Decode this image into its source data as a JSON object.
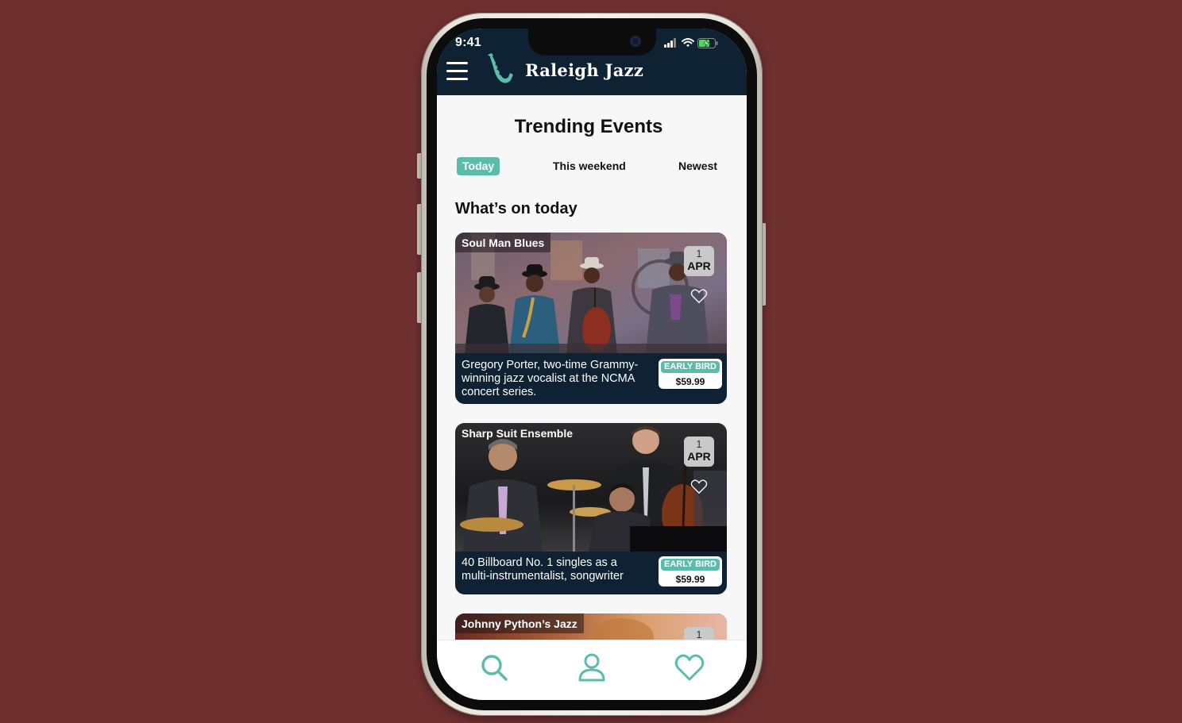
{
  "status_bar": {
    "time": "9:41"
  },
  "app": {
    "name": "Raleigh Jazz"
  },
  "page": {
    "title": "Trending Events"
  },
  "tabs": [
    {
      "label": "Today",
      "active": true
    },
    {
      "label": "This weekend",
      "active": false
    },
    {
      "label": "Newest",
      "active": false
    }
  ],
  "section": {
    "heading": "What’s on today"
  },
  "events": [
    {
      "title": "Soul Man Blues",
      "day": "1",
      "month": "APR",
      "desc_lines": [
        "Gregory Porter, two-time Grammy-",
        "winning jazz vocalist at the NCMA",
        "concert series."
      ],
      "badge": "EARLY BIRD",
      "price": "$59.99"
    },
    {
      "title": "Sharp Suit Ensemble",
      "day": "1",
      "month": "APR",
      "desc_lines": [
        "40 Billboard No. 1 singles as a",
        "multi-instrumentalist, songwriter"
      ],
      "badge": "EARLY BIRD",
      "price": "$59.99"
    },
    {
      "title": "Johnny Python’s Jazz",
      "day": "1"
    }
  ],
  "colors": {
    "background": "#6e2f2f",
    "header": "#0e2233",
    "accent": "#5bbcac"
  },
  "nav": {
    "items": [
      {
        "icon": "search-icon"
      },
      {
        "icon": "user-icon"
      },
      {
        "icon": "heart-icon"
      }
    ]
  }
}
